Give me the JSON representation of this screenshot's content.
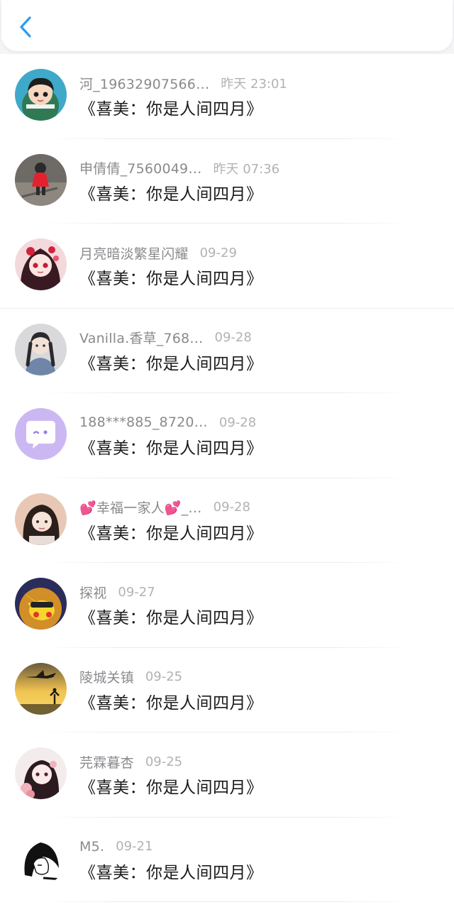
{
  "header": {
    "back_icon": "chevron-left-icon",
    "accent": "#2b9cf2"
  },
  "items": [
    {
      "username": "河_19632907566…",
      "time": "昨天 23:01",
      "message": "《喜美：你是人间四月》",
      "avatar_icon": "cartoon-boy-avatar"
    },
    {
      "username": "申倩倩_7560049…",
      "time": "昨天 07:36",
      "message": "《喜美：你是人间四月》",
      "avatar_icon": "child-red-coat-avatar"
    },
    {
      "username": "月亮暗淡繁星闪耀",
      "time": "09-29",
      "message": "《喜美：你是人间四月》",
      "avatar_icon": "anime-girl-red-avatar"
    },
    {
      "username": "Vanilla.香草_768…",
      "time": "09-28",
      "message": "《喜美：你是人间四月》",
      "avatar_icon": "girl-braids-avatar"
    },
    {
      "username": "188***885_8720…",
      "time": "09-28",
      "message": "《喜美：你是人间四月》",
      "avatar_icon": "default-chat-bubble-avatar"
    },
    {
      "username": "💕幸福一家人💕_…",
      "time": "09-28",
      "message": "《喜美：你是人间四月》",
      "avatar_icon": "girl-portrait-avatar"
    },
    {
      "username": "探视",
      "time": "09-27",
      "message": "《喜美：你是人间四月》",
      "avatar_icon": "pikachu-avatar"
    },
    {
      "username": "陵城关镇",
      "time": "09-25",
      "message": "《喜美：你是人间四月》",
      "avatar_icon": "sunset-plane-avatar"
    },
    {
      "username": "芫霖暮杏",
      "time": "09-25",
      "message": "《喜美：你是人间四月》",
      "avatar_icon": "anime-girl-roses-avatar"
    },
    {
      "username": "M5.",
      "time": "09-21",
      "message": "《喜美：你是人间四月》",
      "avatar_icon": "bw-sketch-avatar"
    }
  ]
}
